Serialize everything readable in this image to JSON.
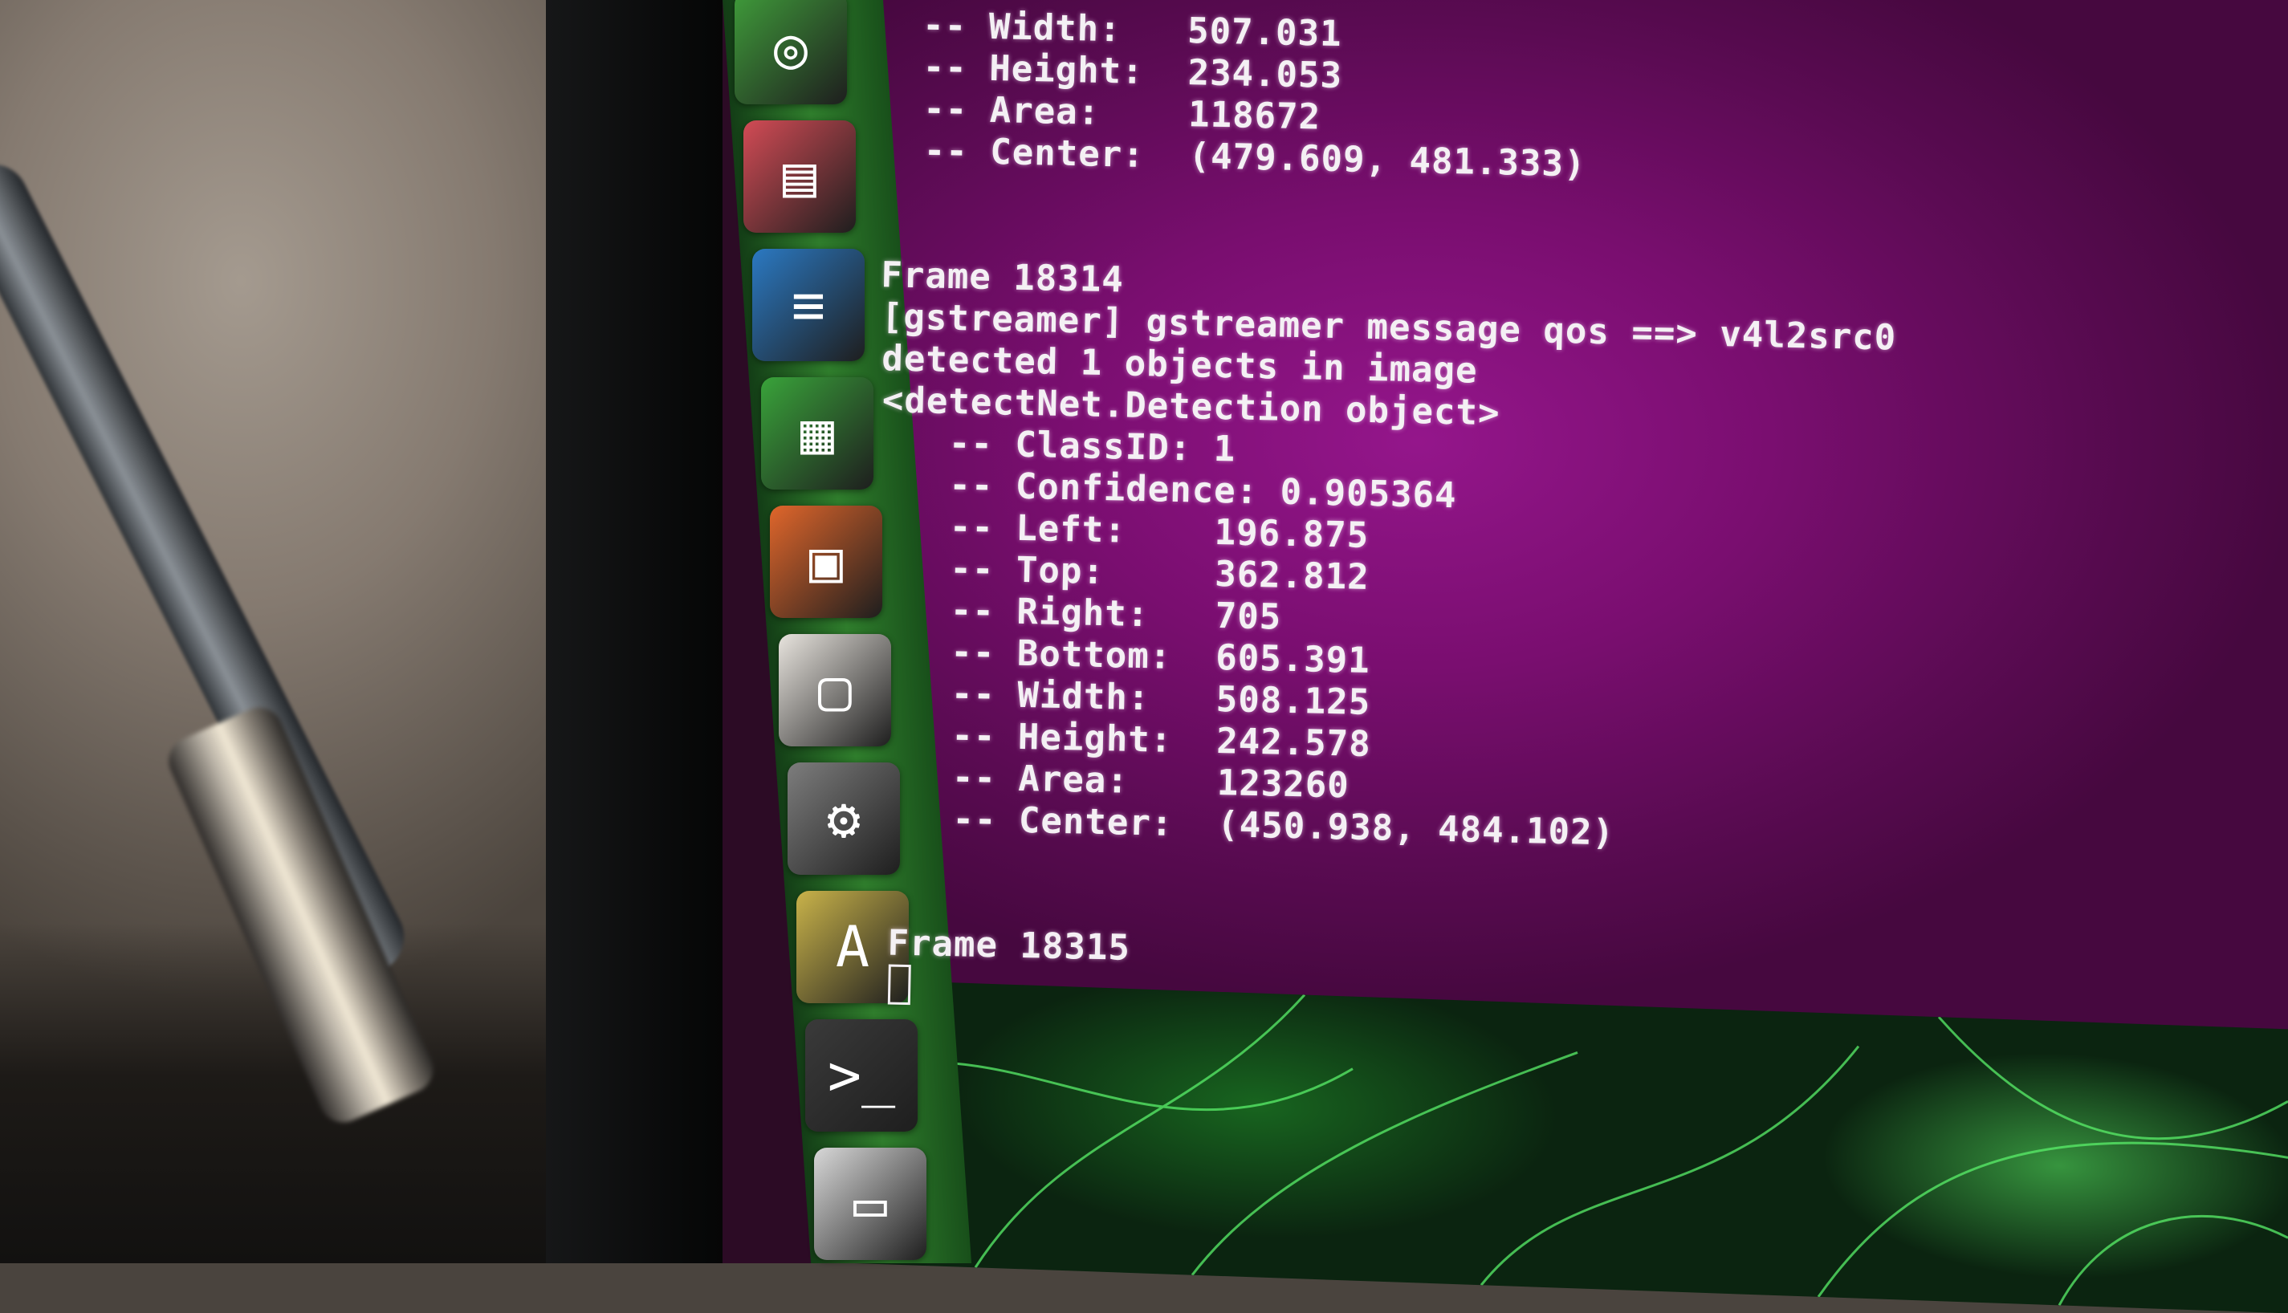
{
  "launcher": {
    "items": [
      {
        "name": "ubuntu-dash",
        "icon": "ubuntu-logo-icon",
        "color": "#3f9b3a"
      },
      {
        "name": "files",
        "icon": "file-cabinet-icon",
        "color": "#d24b55"
      },
      {
        "name": "libreoffice-writer",
        "icon": "document-icon",
        "color": "#2b79c2"
      },
      {
        "name": "libreoffice-calc",
        "icon": "spreadsheet-icon",
        "color": "#39a33a"
      },
      {
        "name": "libreoffice-impress",
        "icon": "presentation-icon",
        "color": "#e0662b"
      },
      {
        "name": "software",
        "icon": "shopping-bag-icon",
        "color": "#e8e4de"
      },
      {
        "name": "system-settings",
        "icon": "gear-wrench-icon",
        "color": "#7d7d7d"
      },
      {
        "name": "software-updater",
        "icon": "updater-a-icon",
        "color": "#c9b34a"
      },
      {
        "name": "terminal",
        "icon": "terminal-icon",
        "color": "#3a3a3a"
      },
      {
        "name": "trash-or-drive",
        "icon": "drive-icon",
        "color": "#d8d8d8"
      }
    ]
  },
  "terminal": {
    "lines": [
      "  -- Width:   507.031",
      "  -- Height:  234.053",
      "  -- Area:    118672",
      "  -- Center:  (479.609, 481.333)",
      "",
      "",
      "Frame 18314",
      "[gstreamer] gstreamer message qos ==> v4l2src0",
      "detected 1 objects in image",
      "<detectNet.Detection object>",
      "   -- ClassID: 1",
      "   -- Confidence: 0.905364",
      "   -- Left:    196.875",
      "   -- Top:     362.812",
      "   -- Right:   705",
      "   -- Bottom:  605.391",
      "   -- Width:   508.125",
      "   -- Height:  242.578",
      "   -- Area:    123260",
      "   -- Center:  (450.938, 484.102)",
      "",
      "",
      "Frame 18315"
    ]
  },
  "colors": {
    "terminal_bg": "#8a1280",
    "terminal_text": "#f4f0f4",
    "launcher": "#2f7d2c",
    "wallpaper_glow": "#4de85a"
  }
}
